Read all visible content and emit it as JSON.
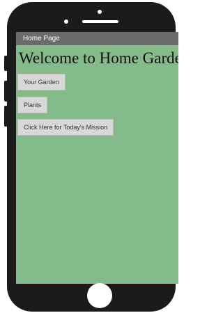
{
  "app": {
    "title_bar": "Home Page"
  },
  "main": {
    "heading": "Welcome to Home Garden!",
    "buttons": [
      {
        "label": "Your Garden"
      },
      {
        "label": "Plants"
      },
      {
        "label": "Click Here for Today's Mission"
      }
    ]
  },
  "colors": {
    "screen_background": "#85bb8a",
    "title_bar_background": "#6b6b6b",
    "button_background": "#d8d8d8",
    "phone_frame": "#1b1b1b"
  }
}
